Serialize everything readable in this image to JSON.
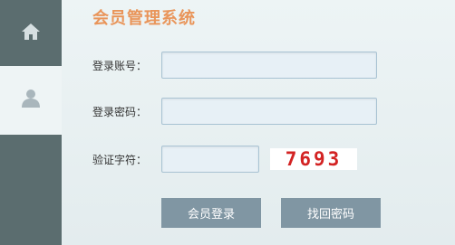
{
  "title": "会员管理系统",
  "sidebar": {
    "home_icon": "home-icon",
    "user_icon": "user-icon"
  },
  "form": {
    "account_label": "登录账号：",
    "account_value": "",
    "password_label": "登录密码：",
    "password_value": "",
    "captcha_label": "验证字符：",
    "captcha_value": "",
    "captcha_code": "7693"
  },
  "buttons": {
    "login": "会员登录",
    "forgot": "找回密码"
  },
  "colors": {
    "title": "#e9955a",
    "sidebar_dark": "#5b6d6f",
    "button": "#8096a3",
    "captcha_text": "#d32323"
  }
}
